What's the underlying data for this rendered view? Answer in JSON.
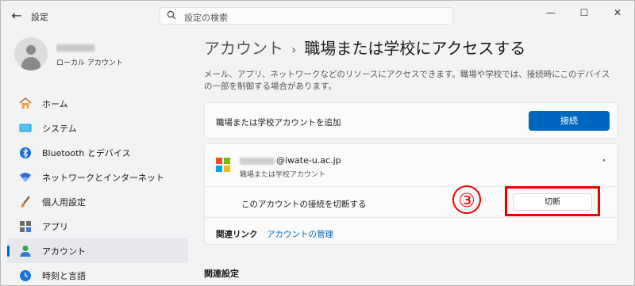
{
  "titlebar": {
    "back_icon": "arrow-left-icon",
    "app_title": "設定",
    "search_placeholder": "設定の検索",
    "controls": [
      "—",
      "☐",
      "✕"
    ]
  },
  "profile": {
    "subtitle": "ローカル アカウント"
  },
  "sidebar": {
    "items": [
      {
        "label": "ホーム",
        "icon": "home-icon"
      },
      {
        "label": "システム",
        "icon": "system-icon"
      },
      {
        "label": "Bluetooth とデバイス",
        "icon": "bluetooth-icon"
      },
      {
        "label": "ネットワークとインターネット",
        "icon": "wifi-icon"
      },
      {
        "label": "個人用設定",
        "icon": "brush-icon"
      },
      {
        "label": "アプリ",
        "icon": "apps-icon"
      },
      {
        "label": "アカウント",
        "icon": "account-icon",
        "active": true
      },
      {
        "label": "時刻と言語",
        "icon": "clock-icon"
      }
    ]
  },
  "main": {
    "breadcrumb_parent": "アカウント",
    "breadcrumb_sep": "›",
    "breadcrumb_current": "職場または学校にアクセスする",
    "description": "メール、アプリ、ネットワークなどのリソースにアクセスできます。職場や学校では、接続時にこのデバイスの一部を制御する場合があります。",
    "add_card": {
      "label": "職場または学校アカウントを追加",
      "button": "接続"
    },
    "account_card": {
      "email": "@iwate-u.ac.jp",
      "type": "職場または学校アカウント",
      "chevron": "˄",
      "disconnect_label": "このアカウントの接続を切断する",
      "disconnect_button": "切断",
      "annotation": "③",
      "related_label": "関連リンク",
      "related_link": "アカウントの管理"
    },
    "related_settings": "関連設定"
  },
  "colors": {
    "accent": "#0067c0",
    "highlight": "#e00000",
    "ms_red": "#f25022",
    "ms_green": "#7fba00",
    "ms_blue": "#00a4ef",
    "ms_yellow": "#ffb900"
  }
}
